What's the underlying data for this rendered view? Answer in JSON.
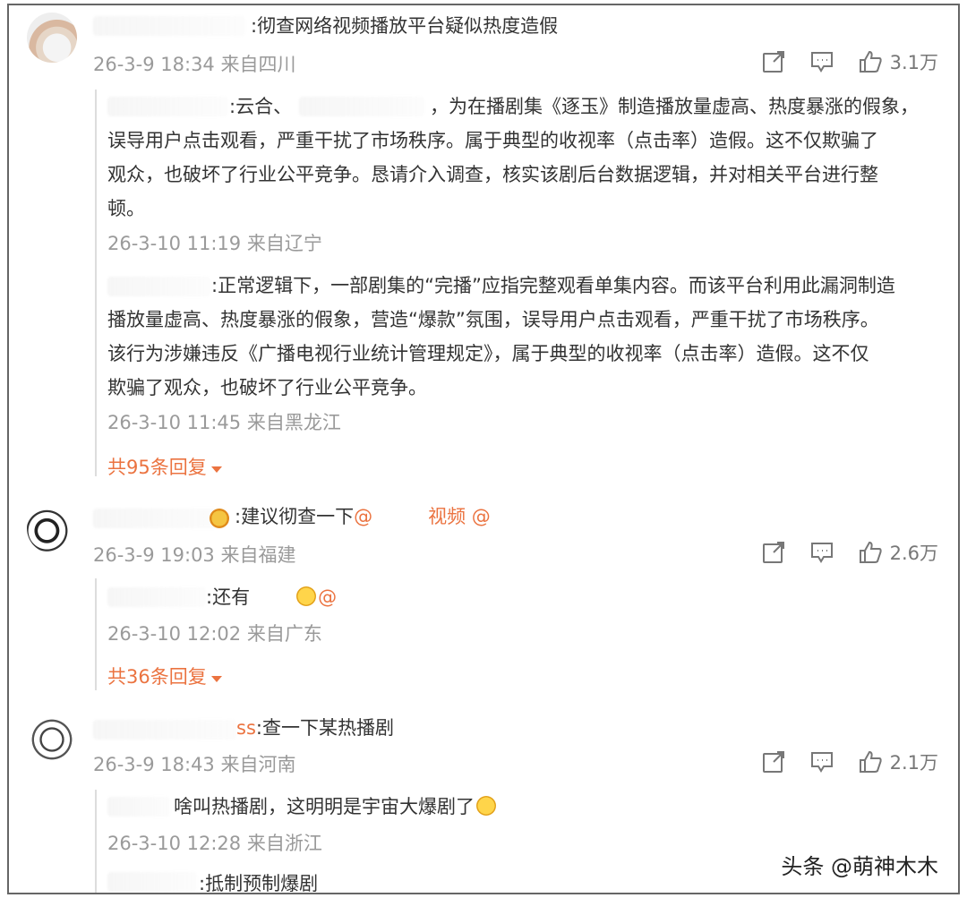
{
  "comments": [
    {
      "text": ":彻查网络视频播放平台疑似热度造假",
      "meta": "26-3-9 18:34 来自四川",
      "likes": "3.1万",
      "replies": [
        {
          "lines": [
            ":云合、",
            "，为在播剧集《逐玉》制造播放量虚高、热度暴涨的假象，",
            "误导用户点击观看，严重干扰了市场秩序。属于典型的收视率（点击率）造假。这不仅欺骗了",
            "观众，也破坏了行业公平竞争。恳请介入调查，核实该剧后台数据逻辑，并对相关平台进行整",
            "顿。"
          ],
          "meta": "26-3-10 11:19 来自辽宁"
        },
        {
          "lines": [
            ":正常逻辑下，一部剧集的“完播”应指完整观看单集内容。而该平台利用此漏洞制造",
            "播放量虚高、热度暴涨的假象，营造“爆款”氛围，误导用户点击观看，严重干扰了市场秩序。",
            "该行为涉嫌违反《广播电视行业统计管理规定》，属于典型的收视率（点击率）造假。这不仅",
            "欺骗了观众，也破坏了行业公平竞争。"
          ],
          "meta": "26-3-10 11:45 来自黑龙江"
        }
      ],
      "reply_count": "共95条回复"
    },
    {
      "text_prefix": ":建议彻查一下",
      "mention1": "@",
      "text_mid": "视频",
      "mention2": "@",
      "meta": "26-3-9 19:03 来自福建",
      "likes": "2.6万",
      "replies": [
        {
          "text": ":还有",
          "mention": "@",
          "meta": "26-3-10 12:02 来自广东"
        }
      ],
      "reply_count": "共36条回复"
    },
    {
      "name_tail": "ss",
      "text": ":查一下某热播剧",
      "meta": "26-3-9 18:43 来自河南",
      "likes": "2.1万",
      "replies": [
        {
          "text": "啥叫热播剧，这明明是宇宙大爆剧了",
          "meta": "26-3-10 12:28 来自浙江"
        },
        {
          "text": ":抵制预制爆剧"
        }
      ]
    }
  ],
  "icons": [
    "share-icon",
    "comment-icon",
    "thumbs-up-icon"
  ],
  "watermark": "头条 @萌神木木",
  "colors": {
    "accent": "#eb7340",
    "meta": "#9a9a9a",
    "text": "#333333"
  }
}
